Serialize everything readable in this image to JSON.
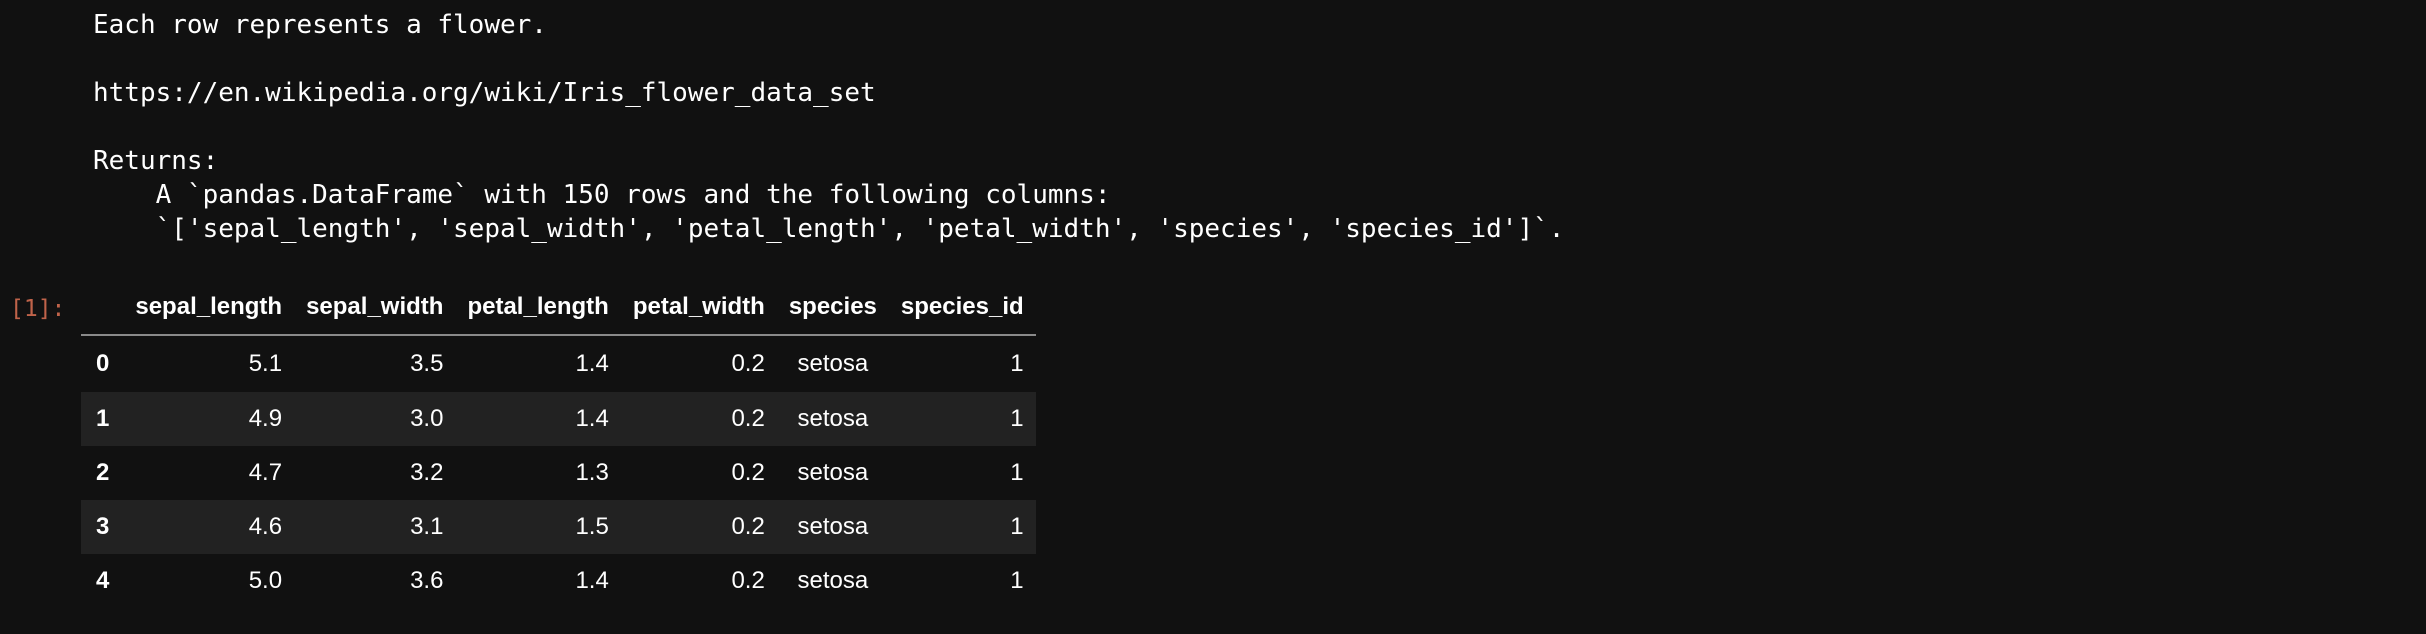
{
  "docstring": {
    "lines": [
      "Each row represents a flower.",
      "",
      "https://en.wikipedia.org/wiki/Iris_flower_data_set",
      "",
      "Returns:",
      "    A `pandas.DataFrame` with 150 rows and the following columns:",
      "    `['sepal_length', 'sepal_width', 'petal_length', 'petal_width', 'species', 'species_id']`."
    ]
  },
  "cell": {
    "prompt": "[1]:"
  },
  "dataframe": {
    "columns": [
      "",
      "sepal_length",
      "sepal_width",
      "petal_length",
      "petal_width",
      "species",
      "species_id"
    ],
    "rows": [
      {
        "index": "0",
        "sepal_length": "5.1",
        "sepal_width": "3.5",
        "petal_length": "1.4",
        "petal_width": "0.2",
        "species": "setosa",
        "species_id": "1"
      },
      {
        "index": "1",
        "sepal_length": "4.9",
        "sepal_width": "3.0",
        "petal_length": "1.4",
        "petal_width": "0.2",
        "species": "setosa",
        "species_id": "1"
      },
      {
        "index": "2",
        "sepal_length": "4.7",
        "sepal_width": "3.2",
        "petal_length": "1.3",
        "petal_width": "0.2",
        "species": "setosa",
        "species_id": "1"
      },
      {
        "index": "3",
        "sepal_length": "4.6",
        "sepal_width": "3.1",
        "petal_length": "1.5",
        "petal_width": "0.2",
        "species": "setosa",
        "species_id": "1"
      },
      {
        "index": "4",
        "sepal_length": "5.0",
        "sepal_width": "3.6",
        "petal_length": "1.4",
        "petal_width": "0.2",
        "species": "setosa",
        "species_id": "1"
      }
    ]
  },
  "colors": {
    "background": "#111111",
    "text": "#ffffff",
    "prompt": "#c0634a",
    "stripe": "#222222",
    "header_rule": "#8a8a8a"
  }
}
